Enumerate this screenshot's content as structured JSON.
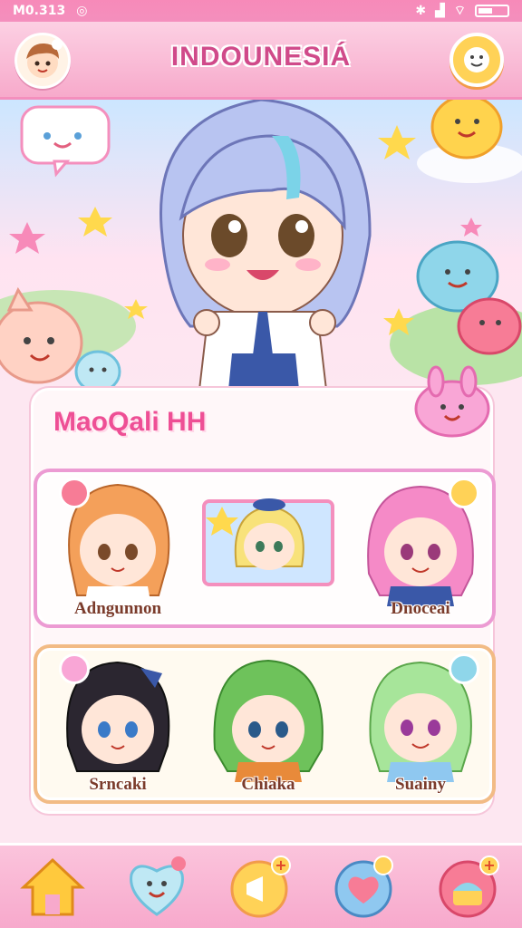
{
  "status": {
    "time": "M0.313"
  },
  "header": {
    "title": "INDOUNESIÁ"
  },
  "panel": {
    "title": "MaoQali HH"
  },
  "characters": [
    {
      "name": "Adngunnon",
      "color": "#f4a05a"
    },
    {
      "name": "",
      "color": "#f8e27a"
    },
    {
      "name": "Dnoceai",
      "color": "#f58ac7"
    },
    {
      "name": "Srncaki",
      "color": "#2b2630"
    },
    {
      "name": "Chiaka",
      "color": "#6ec25b"
    },
    {
      "name": "Suainy",
      "color": "#a7e59a"
    }
  ],
  "nav": [
    {
      "icon": "home-icon"
    },
    {
      "icon": "heart-face-icon"
    },
    {
      "icon": "megaphone-add-icon"
    },
    {
      "icon": "heart-add-icon"
    },
    {
      "icon": "cake-add-icon"
    }
  ],
  "colors": {
    "accent": "#f48fbd",
    "title": "#d04a8a"
  }
}
